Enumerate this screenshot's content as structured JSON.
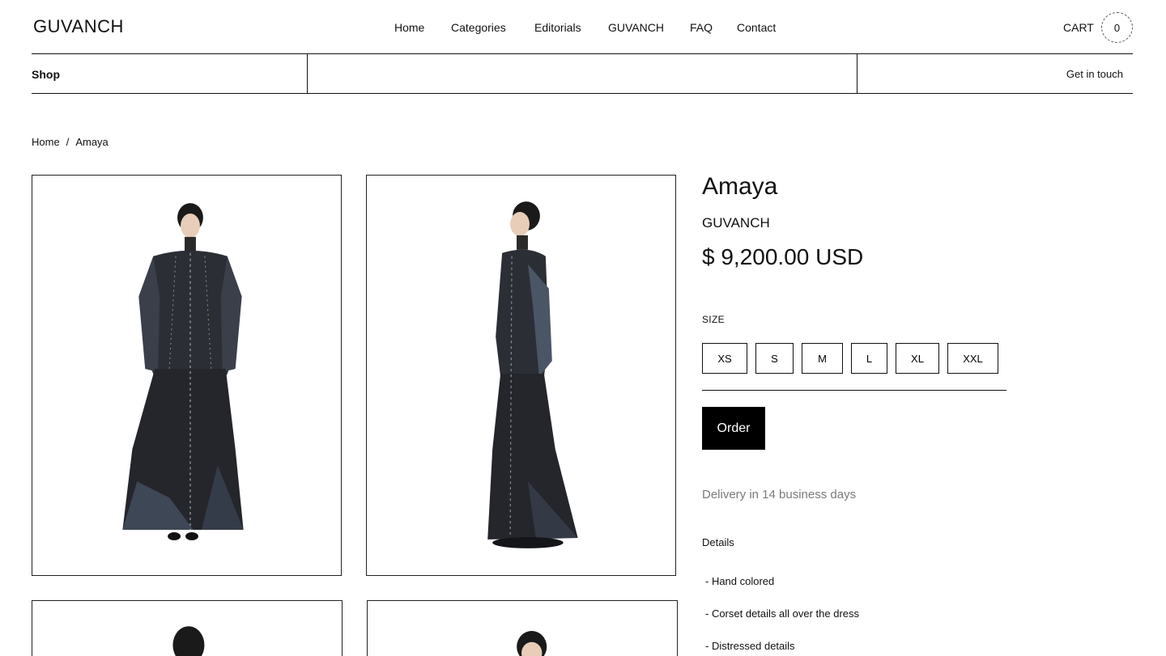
{
  "header": {
    "logo": "GUVANCH",
    "nav": [
      "Home",
      "Categories",
      "Editorials",
      "GUVANCH",
      "FAQ",
      "Contact"
    ],
    "cart_label": "CART",
    "cart_count": "0"
  },
  "subbar": {
    "shop": "Shop",
    "contact": "Get in touch"
  },
  "breadcrumb": {
    "home": "Home",
    "sep": "/",
    "current": "Amaya"
  },
  "product": {
    "title": "Amaya",
    "brand": "GUVANCH",
    "price": "$ 9,200.00 USD",
    "size_label": "SIZE",
    "sizes": [
      "XS",
      "S",
      "M",
      "L",
      "XL",
      "XXL"
    ],
    "order_label": "Order",
    "delivery": "Delivery in 14 business days",
    "details_heading": "Details",
    "details": [
      "- Hand colored",
      "- Corset details all over the dress",
      "- Distressed details"
    ]
  },
  "colors": {
    "text": "#111111",
    "muted": "#7a7a7a",
    "button_bg": "#000000",
    "background": "#ffffff"
  }
}
